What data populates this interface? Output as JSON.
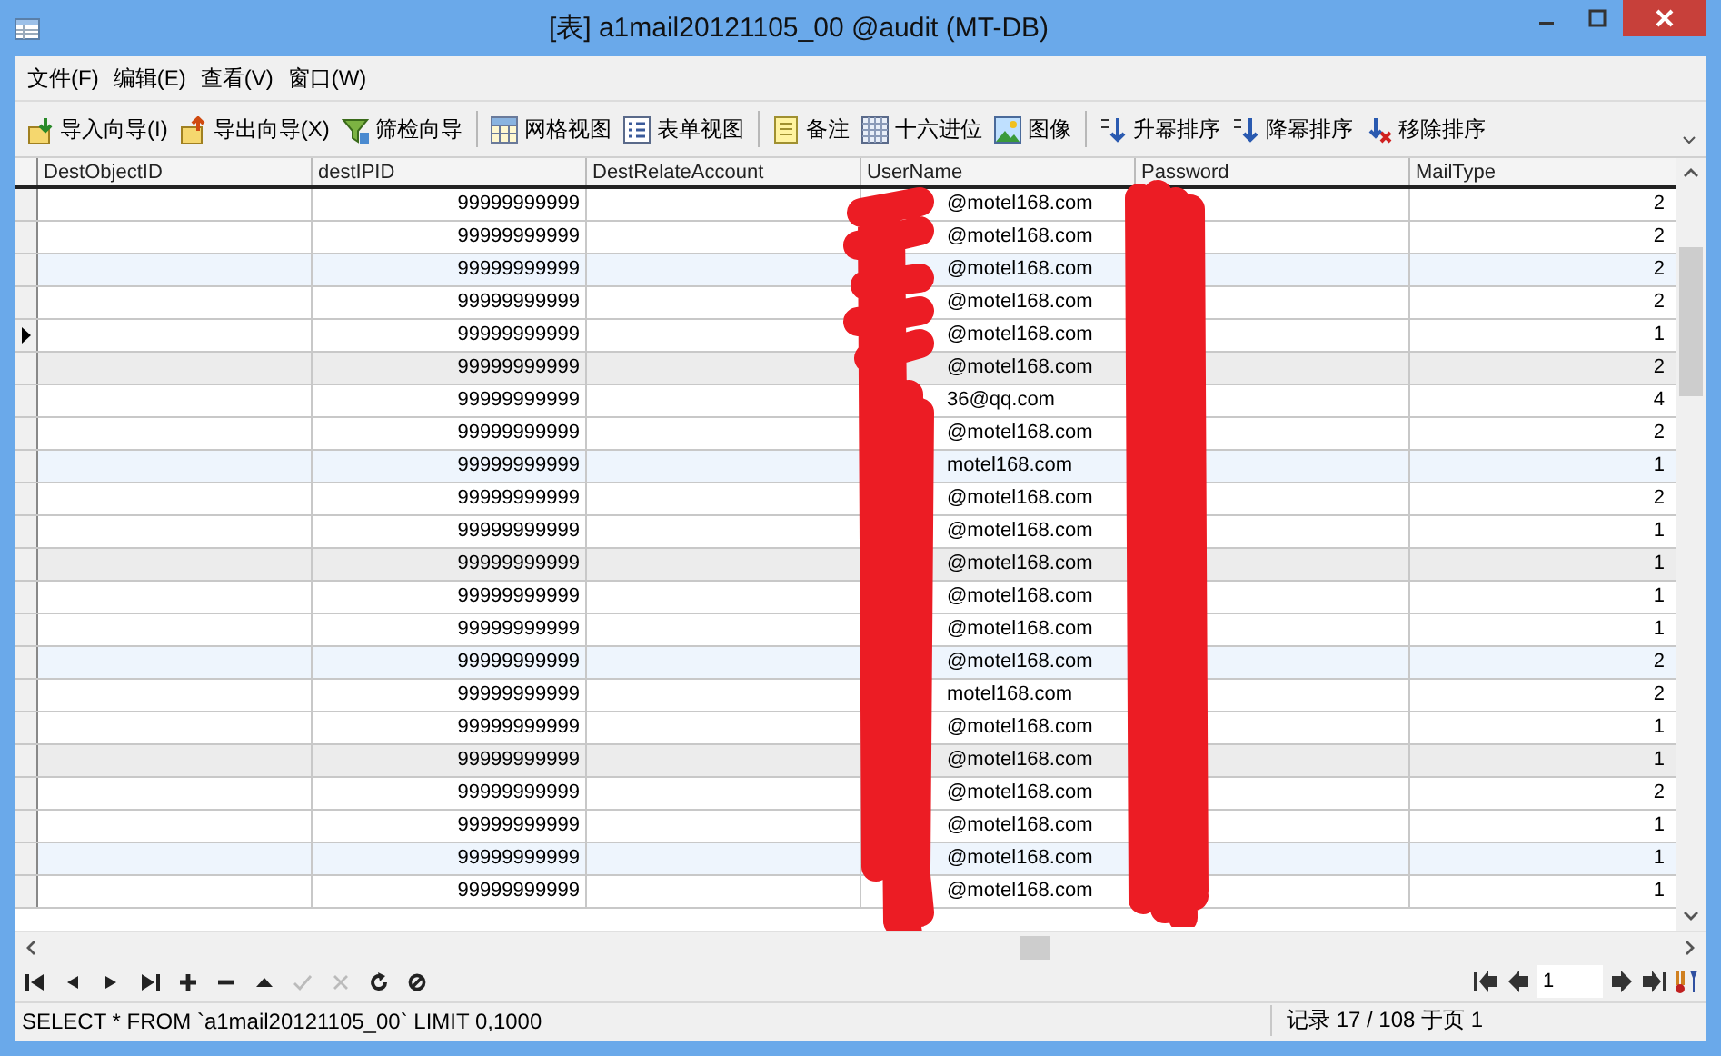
{
  "window": {
    "title": "[表] a1mail20121105_00 @audit (MT-DB)"
  },
  "menu": [
    "文件(F)",
    "编辑(E)",
    "查看(V)",
    "窗口(W)"
  ],
  "toolbar": [
    [
      {
        "kind": "import",
        "label": "导入向导(I)"
      },
      {
        "kind": "export",
        "label": "导出向导(X)"
      },
      {
        "kind": "filter",
        "label": "筛检向导"
      }
    ],
    [
      {
        "kind": "grid",
        "label": "网格视图"
      },
      {
        "kind": "form",
        "label": "表单视图"
      }
    ],
    [
      {
        "kind": "memo",
        "label": "备注"
      },
      {
        "kind": "hex",
        "label": "十六进位"
      },
      {
        "kind": "image",
        "label": "图像"
      }
    ],
    [
      {
        "kind": "sort-asc",
        "label": "升幂排序"
      },
      {
        "kind": "sort-desc",
        "label": "降幂排序"
      },
      {
        "kind": "sort-remove",
        "label": "移除排序"
      }
    ]
  ],
  "table": {
    "columns": [
      "DestObjectID",
      "destIPID",
      "DestRelateAccount",
      "UserName",
      "Password",
      "MailType"
    ],
    "rows": [
      {
        "selected": false,
        "kind": "plain",
        "dest_ipid": "99999999999",
        "user_name": "@motel168.com",
        "mail_type": "2"
      },
      {
        "selected": false,
        "kind": "plain",
        "dest_ipid": "99999999999",
        "user_name": "@motel168.com",
        "mail_type": "2"
      },
      {
        "selected": false,
        "kind": "alt",
        "dest_ipid": "99999999999",
        "user_name": "@motel168.com",
        "mail_type": "2"
      },
      {
        "selected": false,
        "kind": "plain",
        "dest_ipid": "99999999999",
        "user_name": "@motel168.com",
        "mail_type": "2"
      },
      {
        "selected": true,
        "kind": "plain",
        "dest_ipid": "99999999999",
        "user_name": "@motel168.com",
        "mail_type": "1"
      },
      {
        "selected": false,
        "kind": "marked",
        "dest_ipid": "99999999999",
        "user_name": "@motel168.com",
        "mail_type": "2"
      },
      {
        "selected": false,
        "kind": "plain",
        "dest_ipid": "99999999999",
        "user_name": "36@qq.com",
        "mail_type": "4"
      },
      {
        "selected": false,
        "kind": "plain",
        "dest_ipid": "99999999999",
        "user_name": "@motel168.com",
        "mail_type": "2"
      },
      {
        "selected": false,
        "kind": "alt",
        "dest_ipid": "99999999999",
        "user_name": "motel168.com",
        "mail_type": "1"
      },
      {
        "selected": false,
        "kind": "plain",
        "dest_ipid": "99999999999",
        "user_name": "@motel168.com",
        "mail_type": "2"
      },
      {
        "selected": false,
        "kind": "plain",
        "dest_ipid": "99999999999",
        "user_name": "@motel168.com",
        "mail_type": "1"
      },
      {
        "selected": false,
        "kind": "marked",
        "dest_ipid": "99999999999",
        "user_name": "@motel168.com",
        "mail_type": "1"
      },
      {
        "selected": false,
        "kind": "plain",
        "dest_ipid": "99999999999",
        "user_name": "@motel168.com",
        "mail_type": "1"
      },
      {
        "selected": false,
        "kind": "plain",
        "dest_ipid": "99999999999",
        "user_name": "@motel168.com",
        "mail_type": "1"
      },
      {
        "selected": false,
        "kind": "alt",
        "dest_ipid": "99999999999",
        "user_name": "@motel168.com",
        "mail_type": "2"
      },
      {
        "selected": false,
        "kind": "plain",
        "dest_ipid": "99999999999",
        "user_name": "motel168.com",
        "mail_type": "2"
      },
      {
        "selected": false,
        "kind": "plain",
        "dest_ipid": "99999999999",
        "user_name": "@motel168.com",
        "mail_type": "1"
      },
      {
        "selected": false,
        "kind": "marked",
        "dest_ipid": "99999999999",
        "user_name": "@motel168.com",
        "mail_type": "1"
      },
      {
        "selected": false,
        "kind": "plain",
        "dest_ipid": "99999999999",
        "user_name": "@motel168.com",
        "mail_type": "2"
      },
      {
        "selected": false,
        "kind": "plain",
        "dest_ipid": "99999999999",
        "user_name": "@motel168.com",
        "mail_type": "1"
      },
      {
        "selected": false,
        "kind": "alt",
        "dest_ipid": "99999999999",
        "user_name": "@motel168.com",
        "mail_type": "1"
      },
      {
        "selected": false,
        "kind": "plain",
        "dest_ipid": "99999999999",
        "user_name": "@motel168.com",
        "mail_type": "1"
      }
    ]
  },
  "navigator": {
    "buttons": [
      {
        "kind": "first",
        "disabled": false
      },
      {
        "kind": "prev",
        "disabled": false
      },
      {
        "kind": "next",
        "disabled": false
      },
      {
        "kind": "last",
        "disabled": false
      },
      {
        "kind": "add",
        "disabled": false
      },
      {
        "kind": "delete",
        "disabled": false
      },
      {
        "kind": "up",
        "disabled": false
      },
      {
        "kind": "apply",
        "disabled": true
      },
      {
        "kind": "cancel",
        "disabled": true
      },
      {
        "kind": "refresh",
        "disabled": false
      },
      {
        "kind": "stop",
        "disabled": false
      }
    ],
    "page": "1"
  },
  "status_bar": {
    "query": "SELECT * FROM `a1mail20121105_00` LIMIT 0,1000",
    "records": "记录 17 / 108 于页 1"
  }
}
